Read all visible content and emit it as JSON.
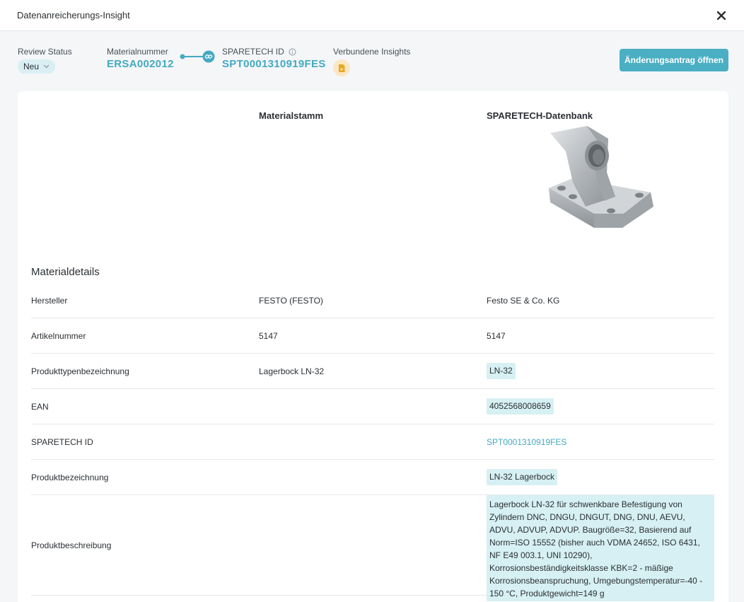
{
  "window": {
    "title": "Datenanreicherungs-Insight",
    "close_icon": "close-icon"
  },
  "header": {
    "review_status_label": "Review Status",
    "review_status_value": "Neu",
    "material_number_label": "Materialnummer",
    "material_number_value": "ERSA002012",
    "sparetech_id_label": "SPARETECH ID",
    "sparetech_id_value": "SPT0001310919FES",
    "linked_insights_label": "Verbundene Insights",
    "cta_label": "Änderungsantrag öffnen"
  },
  "columns": {
    "material_master": "Materialstamm",
    "sparetech_db": "SPARETECH-Datenbank"
  },
  "section": {
    "title": "Materialdetails"
  },
  "rows": [
    {
      "label": "Hersteller",
      "master": "FESTO (FESTO)",
      "sparetech": "Festo SE & Co. KG"
    },
    {
      "label": "Artikelnummer",
      "master": "5147",
      "sparetech": "5147"
    },
    {
      "label": "Produkttypenbezeichnung",
      "master": "Lagerbock LN-32",
      "sparetech": "LN-32"
    },
    {
      "label": "EAN",
      "master": "",
      "sparetech": "4052568008659"
    },
    {
      "label": "SPARETECH ID",
      "master": "",
      "sparetech": "SPT0001310919FES"
    },
    {
      "label": "Produktbezeichnung",
      "master": "",
      "sparetech": "LN-32 Lagerbock"
    },
    {
      "label": "Produktbeschreibung",
      "master": "",
      "sparetech": "Lagerbock LN-32 für schwenkbare Befestigung von Zylindern DNC, DNGU, DNGUT, DNG, DNU, AEVU, ADVU, ADVUP, ADVUP. Baugröße=32, Basierend auf Norm=ISO 15552 (bisher auch VDMA 24652, ISO 6431, NF E49 003.1, UNI 10290), Korrosionsbeständigkeitsklasse KBK=2 - mäßige Korrosionsbeanspruchung, Umgebungstemperatur=-40 - 150 °C, Produktgewicht=149 g"
    }
  ],
  "colors": {
    "accent": "#45a9c0",
    "button": "#4bafc4",
    "highlight": "#d6f0f3",
    "badge": "#fbe7c2"
  }
}
